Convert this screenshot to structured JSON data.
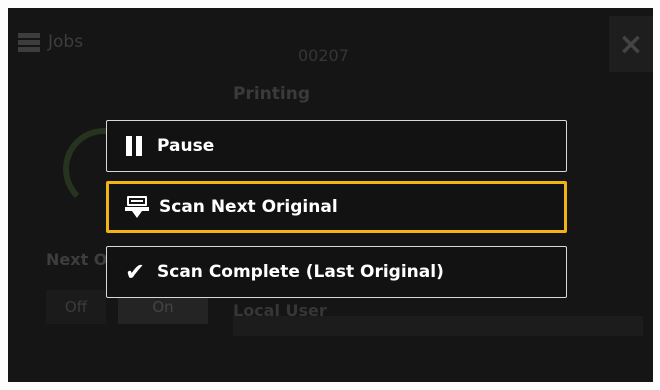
{
  "background": {
    "jobs_label": "Jobs",
    "job_id": "00207",
    "status": "Printing",
    "next_original_label": "Next Original",
    "off_label": "Off",
    "on_label": "On",
    "user": "Local User",
    "close_icon": "×"
  },
  "menu": {
    "items": [
      {
        "icon": "pause-icon",
        "label": "Pause"
      },
      {
        "icon": "scan-icon",
        "label": "Scan Next Original"
      },
      {
        "icon": "checkmark-icon",
        "label": "Scan Complete (Last Original)"
      }
    ],
    "focused_index": 1,
    "focus_color": "#f2b414"
  }
}
